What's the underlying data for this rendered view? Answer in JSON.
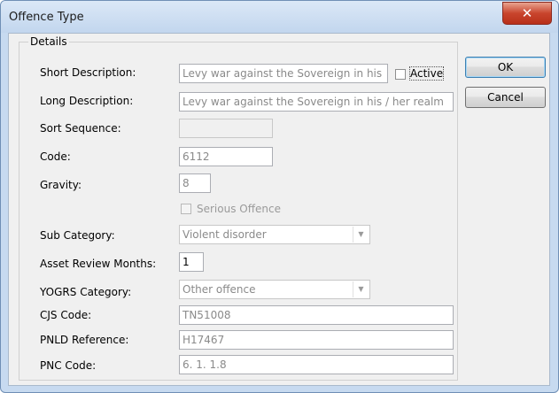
{
  "window": {
    "title": "Offence Type",
    "close_icon": "close-icon"
  },
  "details": {
    "legend": "Details"
  },
  "fields": {
    "short_description": {
      "label": "Short Description:",
      "value": "Levy war against the Sovereign in his"
    },
    "active": {
      "label": "Active",
      "checked": false
    },
    "long_description": {
      "label": "Long Description:",
      "value": "Levy war against the Sovereign in his / her realm"
    },
    "sort_sequence": {
      "label": "Sort Sequence:",
      "value": ""
    },
    "code": {
      "label": "Code:",
      "value": "6112"
    },
    "gravity": {
      "label": "Gravity:",
      "value": "8"
    },
    "serious_offence": {
      "label": "Serious Offence",
      "checked": false
    },
    "sub_category": {
      "label": "Sub Category:",
      "value": "Violent disorder"
    },
    "asset_review_months": {
      "label": "Asset Review Months:",
      "value": "1"
    },
    "yogrs_category": {
      "label": "YOGRS Category:",
      "value": "Other offence"
    },
    "cjs_code": {
      "label": "CJS Code:",
      "value": "TN51008"
    },
    "pnld_reference": {
      "label": "PNLD Reference:",
      "value": "H17467"
    },
    "pnc_code": {
      "label": "PNC Code:",
      "value": "6. 1. 1.8"
    }
  },
  "buttons": {
    "ok": "OK",
    "cancel": "Cancel"
  }
}
